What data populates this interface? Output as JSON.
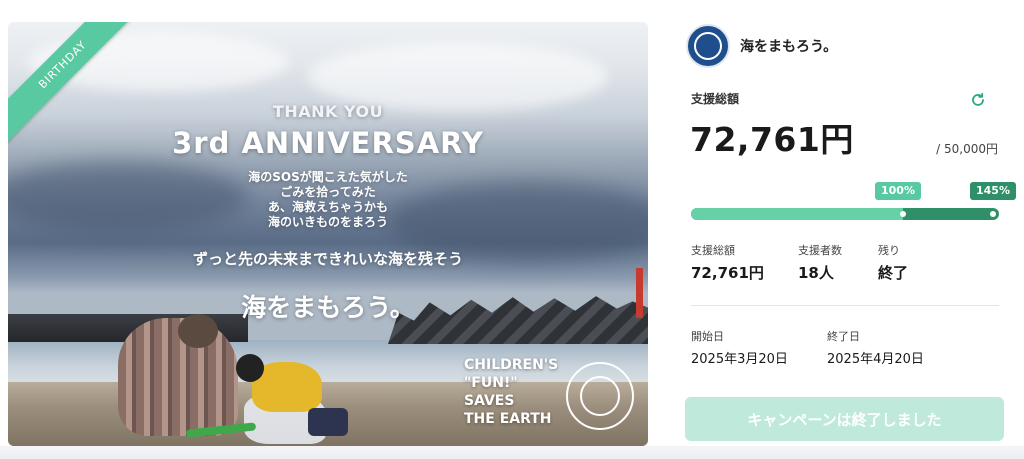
{
  "hero": {
    "ribbon": "BIRTHDAY",
    "thank_you": "THANK YOU",
    "anniversary": "3rd ANNIVERSARY",
    "poem": [
      "海のSOSが聞こえた気がした",
      "ごみを拾ってみた",
      "あ、海救えちゃうかも",
      "海のいきものをまろう"
    ],
    "subline": "ずっと先の未来まできれいな海を残そう",
    "brand": "海をまもろう。",
    "ctf": [
      "CHILDREN'S",
      "\"FUN!\"",
      "SAVES",
      "THE EARTH"
    ]
  },
  "org": {
    "name": "海をまもろう。",
    "logo_icon": "globe-badge-icon"
  },
  "funding": {
    "label": "支援総額",
    "amount": "72,761円",
    "goal": "/ 50,000円",
    "progress_tags": [
      "100%",
      "145%"
    ],
    "progress_percent": 145,
    "refresh_icon": "refresh-icon"
  },
  "stats": [
    {
      "label": "支援総額",
      "value": "72,761円"
    },
    {
      "label": "支援者数",
      "value": "18人"
    },
    {
      "label": "残り",
      "value": "終了"
    }
  ],
  "dates": [
    {
      "label": "開始日",
      "value": "2025年3月20日"
    },
    {
      "label": "終了日",
      "value": "2025年4月20日"
    }
  ],
  "button": {
    "label": "キャンペーンは終了しました"
  },
  "colors": {
    "accent": "#58c9a0",
    "accent_dark": "#2f8f68",
    "button_disabled": "#bfeadb"
  }
}
